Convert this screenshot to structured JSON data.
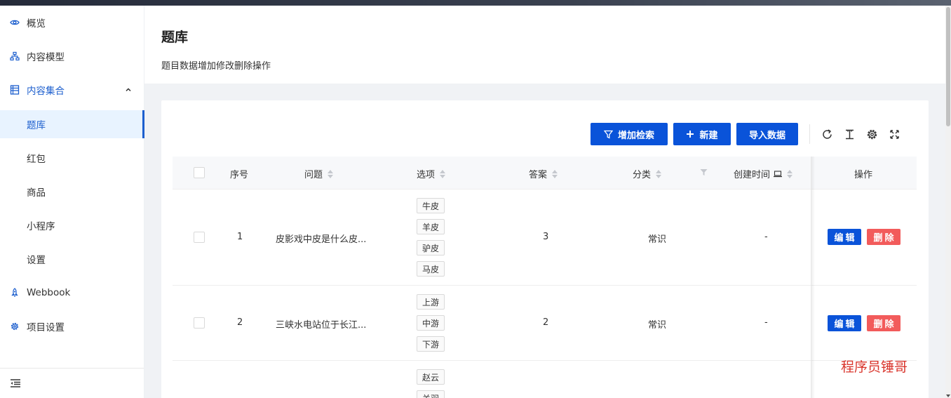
{
  "sidebar": {
    "items": [
      {
        "label": "概览",
        "icon": "eye-icon"
      },
      {
        "label": "内容模型",
        "icon": "sitemap-icon"
      },
      {
        "label": "内容集合",
        "icon": "collection-icon"
      },
      {
        "label": "题库"
      },
      {
        "label": "红包"
      },
      {
        "label": "商品"
      },
      {
        "label": "小程序"
      },
      {
        "label": "设置"
      },
      {
        "label": "Webbook",
        "icon": "rocket-icon"
      },
      {
        "label": "项目设置",
        "icon": "gear-icon"
      }
    ],
    "footer_icon": "menu-fold-icon"
  },
  "header": {
    "title": "题库",
    "description": "题目数据增加修改删除操作"
  },
  "toolbar": {
    "filter_label": "增加检索",
    "new_label": "新建",
    "import_label": "导入数据",
    "icons": [
      "refresh-icon",
      "column-height-icon",
      "settings-icon",
      "fullscreen-icon"
    ]
  },
  "table": {
    "columns": [
      "序号",
      "问题",
      "选项",
      "答案",
      "分类",
      "创建时间",
      "操作"
    ],
    "rows": [
      {
        "index": "1",
        "question": "皮影戏中皮是什么皮...",
        "options": [
          "牛皮",
          "羊皮",
          "驴皮",
          "马皮"
        ],
        "answer": "3",
        "category": "常识",
        "created": "-"
      },
      {
        "index": "2",
        "question": "三峡水电站位于长江...",
        "options": [
          "上游",
          "中游",
          "下游"
        ],
        "answer": "2",
        "category": "常识",
        "created": "-"
      },
      {
        "options": [
          "赵云",
          "关羽"
        ]
      }
    ],
    "edit_label": "编辑",
    "delete_label": "删除"
  },
  "watermark": "程序员锤哥",
  "colors": {
    "primary": "#0a53d9",
    "danger": "#f25b5b",
    "active_bg": "#e8f3ff",
    "watermark": "#d9342b"
  }
}
